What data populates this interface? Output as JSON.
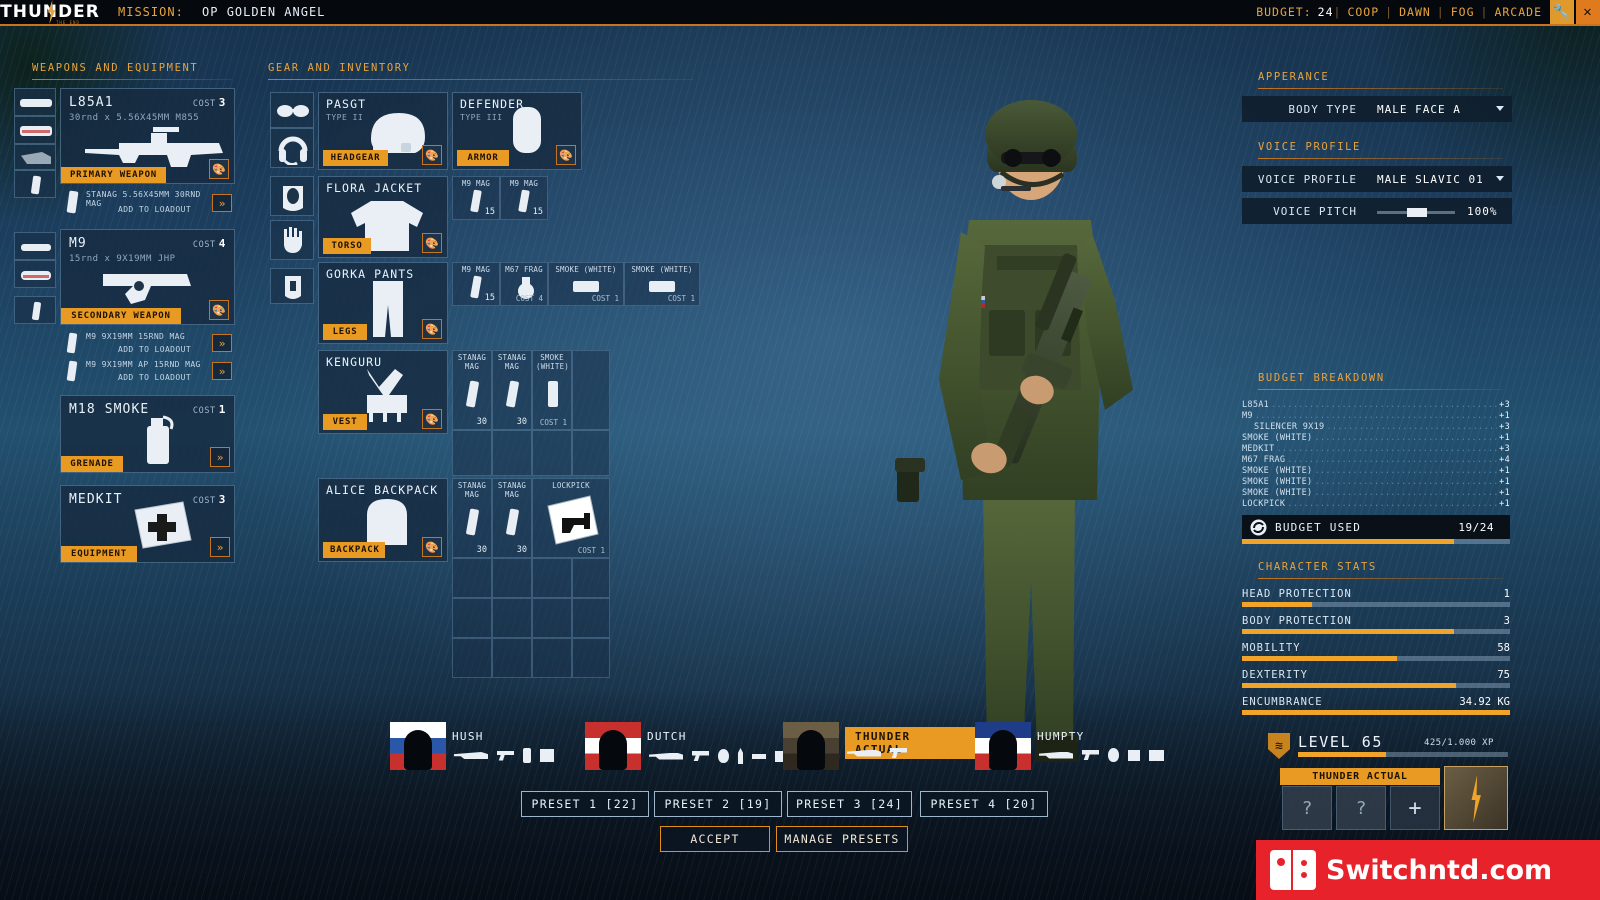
{
  "app": {
    "brand": "THUNDER",
    "brand_sub": "THE END",
    "mission_label": "MISSION:",
    "mission_name": "OP GOLDEN ANGEL"
  },
  "topbar": {
    "budget_label": "BUDGET:",
    "budget_value": "24",
    "mode_coop": "COOP",
    "mode_time": "DAWN",
    "mode_weather": "FOG",
    "mode_type": "ARCADE",
    "settings_icon": "wrench-icon",
    "close_icon": "close-icon",
    "sep": "|"
  },
  "weapons_panel": {
    "title": "WEAPONS AND EQUIPMENT",
    "items": [
      {
        "name": "L85A1",
        "sub": "30rnd x 5.56X45MM M855",
        "cost_label": "COST",
        "cost": "3",
        "tag": "PRIMARY WEAPON",
        "mags": [
          {
            "name": "STANAG 5.56X45MM 30RND MAG",
            "action": "ADD TO LOADOUT"
          }
        ]
      },
      {
        "name": "M9",
        "sub": "15rnd x 9X19MM JHP",
        "cost_label": "COST",
        "cost": "4",
        "tag": "SECONDARY WEAPON",
        "mags": [
          {
            "name": "M9 9X19MM 15RND MAG",
            "action": "ADD TO LOADOUT"
          },
          {
            "name": "M9 9X19MM AP 15RND MAG",
            "action": "ADD TO LOADOUT"
          }
        ]
      },
      {
        "name": "M18 SMOKE",
        "sub": "",
        "cost_label": "COST",
        "cost": "1",
        "tag": "GRENADE",
        "mags": []
      },
      {
        "name": "MEDKIT",
        "sub": "",
        "cost_label": "COST",
        "cost": "3",
        "tag": "EQUIPMENT",
        "mags": []
      }
    ]
  },
  "gear_panel": {
    "title": "GEAR AND INVENTORY",
    "accessory_slots": [
      "glasses-icon",
      "headset-icon",
      "balaclava-icon",
      "gloves-icon",
      "belt-icon"
    ],
    "gear": [
      {
        "name": "PASGT",
        "sub": "TYPE II",
        "tag": "HEADGEAR"
      },
      {
        "name": "DEFENDER",
        "sub": "TYPE III",
        "tag": "ARMOR"
      },
      {
        "name": "FLORA JACKET",
        "sub": "",
        "tag": "TORSO"
      },
      {
        "name": "GORKA PANTS",
        "sub": "",
        "tag": "LEGS"
      },
      {
        "name": "KENGURU",
        "sub": "",
        "tag": "VEST"
      },
      {
        "name": "ALICE BACKPACK",
        "sub": "",
        "tag": "BACKPACK"
      }
    ],
    "armor_pouch_grid": [
      {
        "label": "M9 MAG",
        "num": "15",
        "cost": ""
      },
      {
        "label": "M9 MAG",
        "num": "15",
        "cost": ""
      }
    ],
    "legs_pouch_grid": [
      {
        "label": "M9 MAG",
        "num": "15",
        "cost": ""
      },
      {
        "label": "M67 FRAG",
        "num": "",
        "cost": "COST 4"
      },
      {
        "label": "SMOKE (WHITE)",
        "num": "",
        "cost": "COST 1"
      },
      {
        "label": "SMOKE (WHITE)",
        "num": "",
        "cost": "COST 1"
      }
    ],
    "vest_grid": [
      {
        "label": "STANAG MAG",
        "num": "30",
        "cost": ""
      },
      {
        "label": "STANAG MAG",
        "num": "30",
        "cost": ""
      },
      {
        "label": "SMOKE (WHITE)",
        "num": "",
        "cost": "COST 1"
      },
      {
        "label": "",
        "num": "",
        "cost": ""
      },
      {
        "label": "",
        "num": "",
        "cost": ""
      },
      {
        "label": "",
        "num": "",
        "cost": ""
      },
      {
        "label": "",
        "num": "",
        "cost": ""
      },
      {
        "label": "",
        "num": "",
        "cost": ""
      }
    ],
    "backpack_grid": [
      {
        "label": "STANAG MAG",
        "num": "30",
        "cost": ""
      },
      {
        "label": "STANAG MAG",
        "num": "30",
        "cost": ""
      },
      {
        "label": "LOCKPICK",
        "num": "",
        "cost": "COST 1"
      },
      {
        "label": "",
        "num": "",
        "cost": ""
      }
    ]
  },
  "appearance": {
    "title": "APPERANCE",
    "body_type_label": "BODY TYPE",
    "body_type_value": "MALE FACE A"
  },
  "voice": {
    "title": "VOICE PROFILE",
    "profile_label": "VOICE PROFILE",
    "profile_value": "MALE SLAVIC 01",
    "pitch_label": "VOICE PITCH",
    "pitch_value": "100%",
    "pitch_percent": 45
  },
  "budget_breakdown": {
    "title": "BUDGET BREAKDOWN",
    "lines": [
      {
        "name": "L85A1",
        "value": "+3",
        "indent": false
      },
      {
        "name": "M9",
        "value": "+1",
        "indent": false
      },
      {
        "name": "SILENCER 9X19",
        "value": "+3",
        "indent": true
      },
      {
        "name": "SMOKE (WHITE)",
        "value": "+1",
        "indent": false
      },
      {
        "name": "MEDKIT",
        "value": "+3",
        "indent": false
      },
      {
        "name": "M67 FRAG",
        "value": "+4",
        "indent": false
      },
      {
        "name": "SMOKE (WHITE)",
        "value": "+1",
        "indent": false
      },
      {
        "name": "SMOKE (WHITE)",
        "value": "+1",
        "indent": false
      },
      {
        "name": "SMOKE (WHITE)",
        "value": "+1",
        "indent": false
      },
      {
        "name": "LOCKPICK",
        "value": "+1",
        "indent": false
      }
    ],
    "used_icon": "budget-coin-icon",
    "used_label": "BUDGET USED",
    "used_value": "19/24",
    "used_percent": 79
  },
  "character_stats": {
    "title": "CHARACTER STATS",
    "stats": [
      {
        "name": "HEAD PROTECTION",
        "value": "1",
        "percent": 26
      },
      {
        "name": "BODY PROTECTION",
        "value": "3",
        "percent": 79
      },
      {
        "name": "MOBILITY",
        "value": "58",
        "percent": 58
      },
      {
        "name": "DEXTERITY",
        "value": "75",
        "percent": 80
      },
      {
        "name": "ENCUMBRANCE",
        "value": "34.92 KG",
        "percent": 100
      }
    ]
  },
  "level": {
    "badge_icon": "rank-shield-icon",
    "label": "LEVEL 65",
    "xp": "425/1.000 XP",
    "percent": 42
  },
  "operator_panel": {
    "name": "THUNDER ACTUAL",
    "slots": [
      "?",
      "?",
      "+"
    ]
  },
  "squad": [
    {
      "name": "HUSH",
      "flag": "RU",
      "active": false,
      "icons": [
        "rifle-icon",
        "pistol-icon",
        "smoke-icon",
        "medkit-icon"
      ]
    },
    {
      "name": "DUTCH",
      "flag": "AT",
      "active": false,
      "icons": [
        "rifle-icon",
        "pistol-icon",
        "grenade-icon",
        "knife-icon",
        "syringe-icon",
        "radio-icon"
      ]
    },
    {
      "name": "THUNDER ACTUAL",
      "flag": "TH",
      "active": true,
      "icons": [
        "rifle-icon",
        "pistol-icon"
      ]
    },
    {
      "name": "HUMPTY",
      "flag": "GB",
      "active": false,
      "icons": [
        "smg-icon",
        "pistol-icon",
        "grenade-icon",
        "c4-icon",
        "radio-icon"
      ]
    }
  ],
  "presets": {
    "buttons": [
      {
        "label": "PRESET 1 [22]"
      },
      {
        "label": "PRESET 2 [19]"
      },
      {
        "label": "PRESET 3 [24]"
      },
      {
        "label": "PRESET 4 [20]"
      }
    ],
    "accept": "ACCEPT",
    "manage": "MANAGE PRESETS"
  },
  "watermark": {
    "text": "Switchntd.com",
    "icon": "nintendo-switch-icon"
  },
  "colors": {
    "accent": "#e89a23",
    "accent_dark": "#c8741e",
    "panel": "#16293f",
    "text": "#d6e4f0"
  }
}
